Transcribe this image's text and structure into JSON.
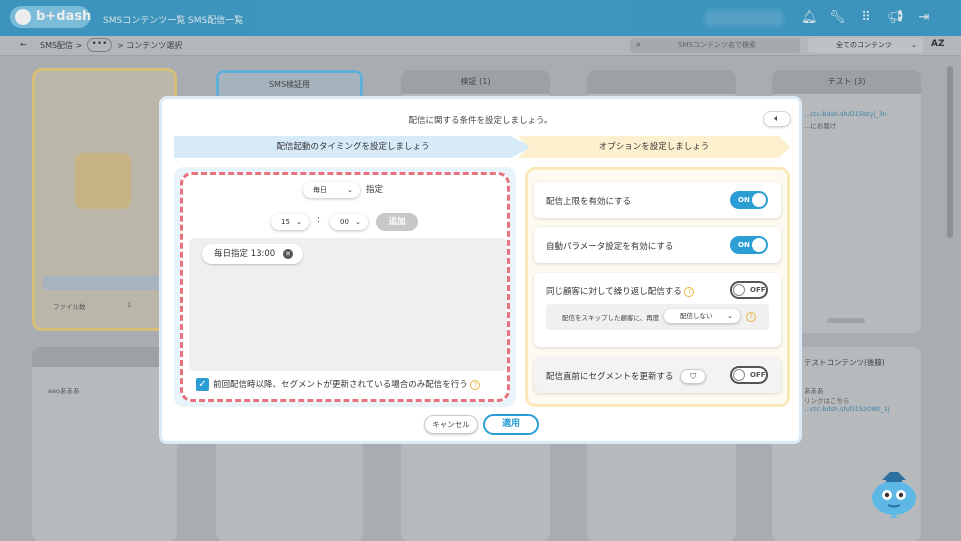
{
  "topbar": {
    "logo": "b+dash",
    "nav": [
      "SMSコンテンツ一覧",
      "SMS配信一覧"
    ]
  },
  "breadcrumb": {
    "back": "←",
    "items": [
      "SMS配信 >",
      "> コンテンツ選択"
    ],
    "more": "•••",
    "search_placeholder": "SMSコンテンツ名で検索",
    "content_filter": "全てのコンテンツ",
    "sort": "AZ"
  },
  "background_cards": {
    "card1_title": "SMS検証用",
    "card2_title": "検証 (1)",
    "card3_title": "テスト (3)",
    "card3_link": "...ctc-bdsh.sh/D15btyj_3n",
    "card3_text": "...にお届け",
    "folder_stat_label": "ファイル数",
    "folder_stat_value": "1",
    "lower_card_text": "aaoあああ",
    "lower_right_title": "テストコンテンツ(後藤)",
    "lower_right_line1": "あああ",
    "lower_right_line2": "リンクはこちら",
    "lower_right_link": "...ctc-bdsh.sh/D15zOWt_1j"
  },
  "modal": {
    "title": "配信に関する条件を設定しましょう。",
    "steps": [
      "配信起動のタイミングを設定しましょう",
      "オプションを設定しましょう"
    ],
    "schedule": {
      "frequency": "毎日",
      "frequency_suffix": "指定",
      "hour": "15",
      "colon": ":",
      "minute": "00",
      "add_button": "追加",
      "chips": [
        "毎日指定 13:00"
      ],
      "segment_only_checkbox": "前回配信時以降、セグメントが更新されている場合のみ配信を行う",
      "segment_only_checked": true
    },
    "options": {
      "limit_label": "配信上限を有効にする",
      "limit_state": "ON",
      "auto_param_label": "自動パラメータ設定を有効にする",
      "auto_param_state": "ON",
      "repeat_label": "同じ顧客に対して繰り返し配信する",
      "repeat_state": "OFF",
      "skip_text": "配信をスキップした顧客に、再度",
      "skip_select": "配信しない",
      "segment_update_label": "配信直前にセグメントを更新する",
      "segment_update_state": "OFF"
    },
    "cancel": "キャンセル",
    "apply": "適用"
  },
  "colors": {
    "primary": "#2b9fd4",
    "dashed_border": "#e8737f",
    "step1_bg": "#d7eaf7",
    "step2_bg": "#fdf0cf",
    "help_icon": "#e5b73b"
  }
}
